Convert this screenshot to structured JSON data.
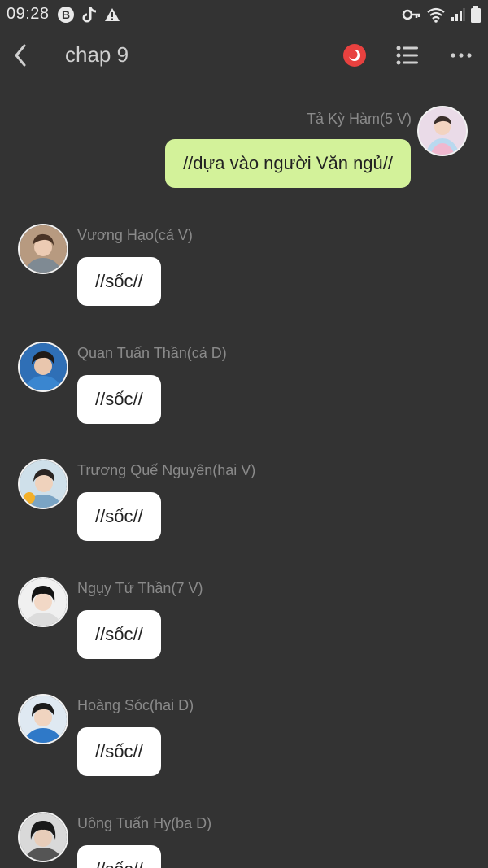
{
  "status_bar": {
    "time": "09:28",
    "left_icons": [
      "b-badge-icon",
      "tiktok-icon",
      "warning-icon"
    ],
    "right_icons": [
      "key-icon",
      "wifi-icon",
      "signal-icon",
      "battery-icon"
    ]
  },
  "header": {
    "title": "chap 9",
    "accent_color": "#e8413f"
  },
  "messages": [
    {
      "sender": "Tả Kỳ Hàm(5 V)",
      "text": "//dựa vào người Văn ngủ//",
      "self": true
    },
    {
      "sender": "Vương Hạo(cả V)",
      "text": "//sốc//",
      "self": false
    },
    {
      "sender": "Quan Tuấn Thần(cả D)",
      "text": "//sốc//",
      "self": false
    },
    {
      "sender": "Trương Quế Nguyên(hai V)",
      "text": "//sốc//",
      "self": false
    },
    {
      "sender": "Ngụy Tử Thần(7 V)",
      "text": "//sốc//",
      "self": false
    },
    {
      "sender": "Hoàng Sóc(hai D)",
      "text": "//sốc//",
      "self": false
    },
    {
      "sender": "Uông Tuấn Hy(ba D)",
      "text": "//sốc//",
      "self": false
    }
  ]
}
